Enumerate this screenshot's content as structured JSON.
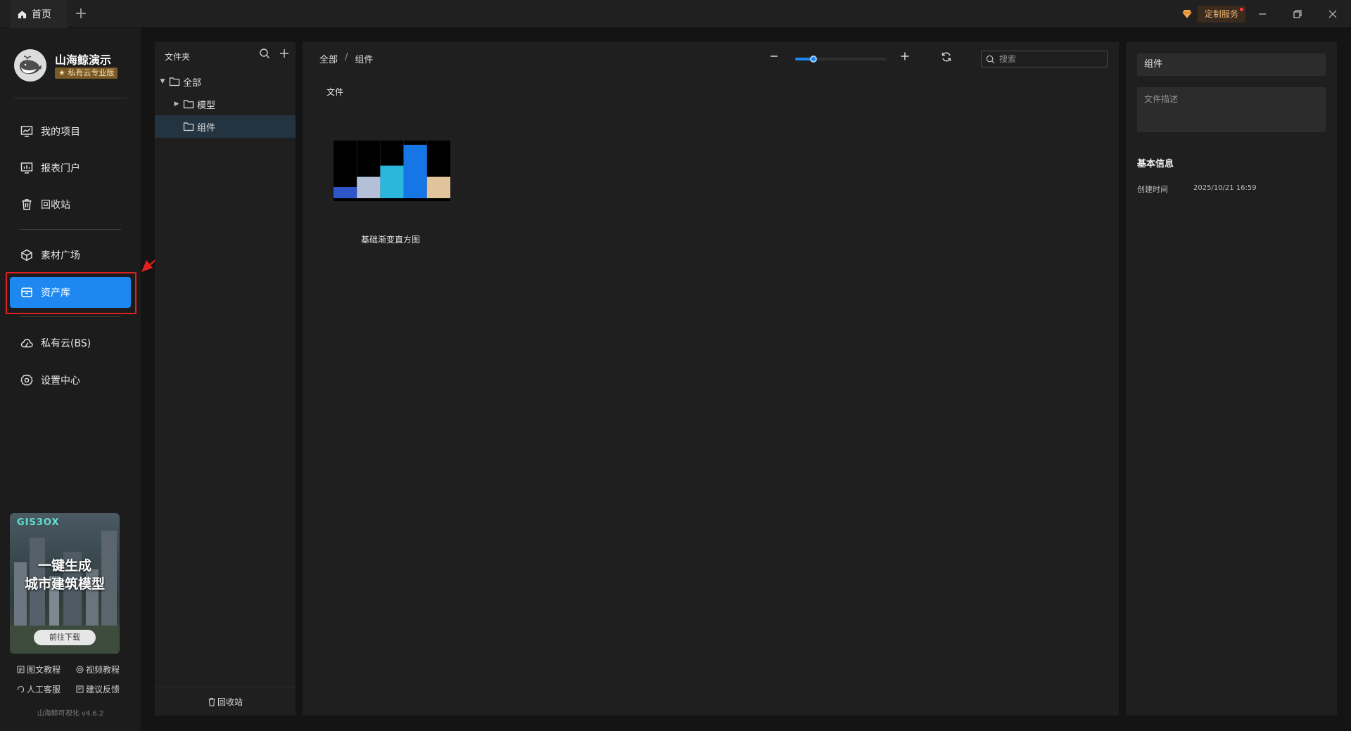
{
  "titlebar": {
    "home_tab_label": "首页",
    "custom_service_label": "定制服务"
  },
  "brand": {
    "name": "山海鲸演示",
    "edition": "私有云专业版"
  },
  "nav": {
    "my_projects": "我的项目",
    "report_portal": "报表门户",
    "recycle_bin": "回收站",
    "material_square": "素材广场",
    "asset_library": "资产库",
    "private_cloud": "私有云(BS)",
    "settings_center": "设置中心"
  },
  "promo": {
    "logo": "GIS3OX",
    "line1": "一键生成",
    "line2": "城市建筑模型",
    "button": "前往下载"
  },
  "help": {
    "graphic_tutorial": "图文教程",
    "video_tutorial": "视频教程",
    "customer_service": "人工客服",
    "feedback": "建议反馈"
  },
  "version": "山海鲸可视化 v4.6.2",
  "folder_panel": {
    "title": "文件夹",
    "tree": {
      "all": "全部",
      "models": "模型",
      "components": "组件"
    },
    "footer_recycle": "回收站"
  },
  "main": {
    "breadcrumb": {
      "root": "全部",
      "separator": "/",
      "current": "组件"
    },
    "zoom_level": 0.2,
    "search_placeholder": "搜索",
    "section_title": "文件",
    "files": [
      {
        "name": "基础渐变直方图",
        "thumbnail_bars": [
          0.2,
          0.38,
          0.58,
          0.95,
          0.38
        ],
        "thumbnail_colors": [
          "#2f56c8",
          "#b4bfd8",
          "#2bb6dc",
          "#1776e6",
          "#e2c49c"
        ]
      }
    ]
  },
  "details": {
    "name_value": "组件",
    "description_placeholder": "文件描述",
    "basic_info_title": "基本信息",
    "created_label": "创建时间",
    "created_value": "2025/10/21 16:59"
  },
  "colors": {
    "accent": "#1e88f0",
    "highlight": "#e02020",
    "service_text": "#f1b476"
  }
}
